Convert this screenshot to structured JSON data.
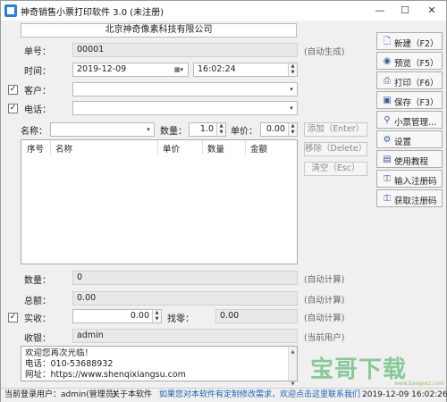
{
  "window": {
    "title": "神奇销售小票打印软件 3.0 (未注册)"
  },
  "store_name": "北京神奇像素科技有限公司",
  "form": {
    "order_no_label": "单号：",
    "order_no_value": "00001",
    "order_no_hint": "(自动生成)",
    "time_label": "时间：",
    "date_value": "2019-12-09",
    "time_value": "16:02:24",
    "customer_label": "客户：",
    "phone_label": "电话：",
    "name_label": "名称：",
    "qty_label": "数量：",
    "qty_value": "1.0",
    "price_label": "单价：",
    "price_value": "0.00"
  },
  "actions": {
    "add": "添加（Enter）",
    "remove": "移除（Delete）",
    "clear": "清空（Esc）"
  },
  "grid": {
    "columns": [
      "序号",
      "名称",
      "单价",
      "数量",
      "金额"
    ]
  },
  "summary": {
    "count_label": "数量：",
    "count_value": "0",
    "count_hint": "(自动计算)",
    "total_label": "总额：",
    "total_value": "0.00",
    "total_hint": "(自动计算)",
    "paid_label": "实收：",
    "paid_value": "0.00",
    "change_label": "找零：",
    "change_value": "0.00",
    "change_hint": "(自动计算)",
    "cashier_label": "收银：",
    "cashier_value": "admin",
    "cashier_hint": "(当前用户)"
  },
  "footer_text": {
    "line1": "欢迎您再次光临！",
    "line2": "电话：010-53688932",
    "line3": "网址：https://www.shenqixiangsu.com"
  },
  "sidebar": {
    "new": "新建（F2）",
    "preview": "预览（F5）",
    "print": "打印（F6）",
    "save": "保存（F3）",
    "ticket_manage": "小票管理...",
    "settings": "设置",
    "tutorial": "使用教程",
    "enter_code": "输入注册码",
    "get_code": "获取注册码"
  },
  "status": {
    "user": "当前登录用户：admin(管理员)",
    "about": "关于本软件",
    "customize": "如果您对本软件有定制修改需求，欢迎点击这里联系我们",
    "datetime": "2019-12-09 16:02:26"
  },
  "watermark": {
    "text": "宝哥下载",
    "url": "www.baogexz.com"
  }
}
